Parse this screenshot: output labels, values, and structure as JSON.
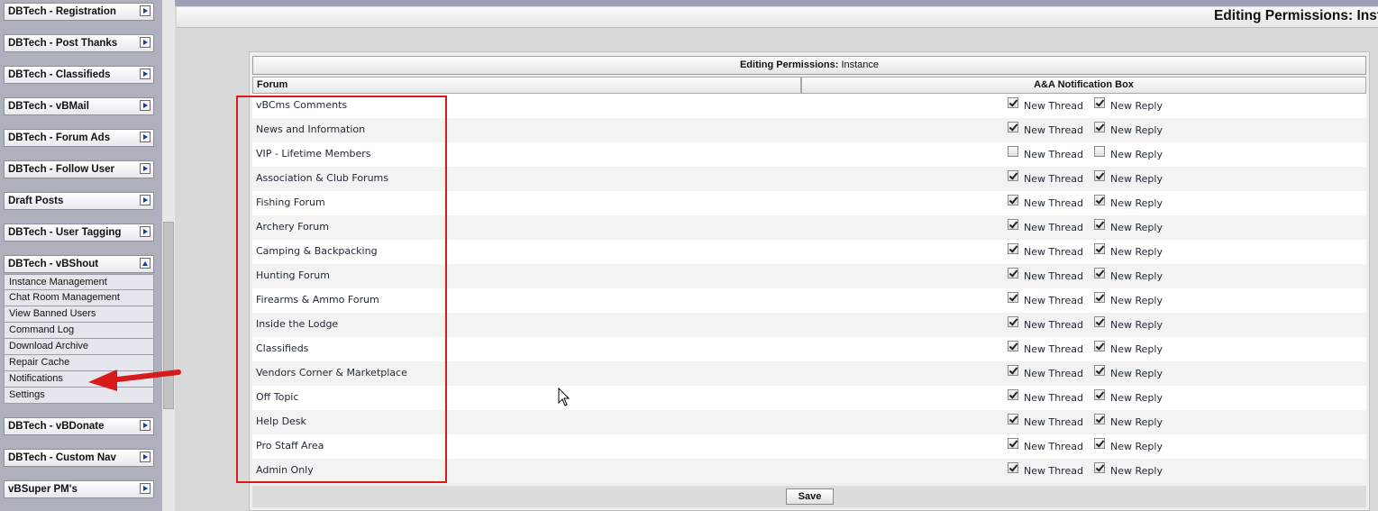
{
  "sidebar": {
    "groups": [
      {
        "label": "DBTech - Registration"
      },
      {
        "label": "DBTech - Post Thanks"
      },
      {
        "label": "DBTech - Classifieds"
      },
      {
        "label": "DBTech - vBMail"
      },
      {
        "label": "DBTech - Forum Ads"
      },
      {
        "label": "DBTech - Follow User"
      },
      {
        "label": "Draft Posts"
      },
      {
        "label": "DBTech - User Tagging"
      },
      {
        "label": "DBTech - vBShout"
      },
      {
        "label": "DBTech - vBDonate"
      },
      {
        "label": "DBTech - Custom Nav"
      },
      {
        "label": "vBSuper PM's"
      }
    ],
    "vbshout_items": [
      "Instance Management",
      "Chat Room Management",
      "View Banned Users",
      "Command Log",
      "Download Archive",
      "Repair Cache",
      "Notifications",
      "Settings"
    ]
  },
  "header": {
    "title": "Editing Permissions: Inst"
  },
  "table": {
    "title_bold": "Editing Permissions:",
    "title_rest": " Instance",
    "col_forum": "Forum",
    "col_box": "A&A Notification Box",
    "new_thread_label": "New Thread",
    "new_reply_label": "New Reply",
    "rows": [
      {
        "forum": "vBCms Comments",
        "new_thread": true,
        "new_reply": true
      },
      {
        "forum": "News and Information",
        "new_thread": true,
        "new_reply": true
      },
      {
        "forum": "VIP - Lifetime Members",
        "new_thread": false,
        "new_reply": false
      },
      {
        "forum": "Association & Club Forums",
        "new_thread": true,
        "new_reply": true
      },
      {
        "forum": "Fishing Forum",
        "new_thread": true,
        "new_reply": true
      },
      {
        "forum": "Archery Forum",
        "new_thread": true,
        "new_reply": true
      },
      {
        "forum": "Camping & Backpacking",
        "new_thread": true,
        "new_reply": true
      },
      {
        "forum": "Hunting Forum",
        "new_thread": true,
        "new_reply": true
      },
      {
        "forum": "Firearms & Ammo Forum",
        "new_thread": true,
        "new_reply": true
      },
      {
        "forum": "Inside the Lodge",
        "new_thread": true,
        "new_reply": true
      },
      {
        "forum": "Classifieds",
        "new_thread": true,
        "new_reply": true
      },
      {
        "forum": "Vendors Corner & Marketplace",
        "new_thread": true,
        "new_reply": true
      },
      {
        "forum": "Off Topic",
        "new_thread": true,
        "new_reply": true
      },
      {
        "forum": "Help Desk",
        "new_thread": true,
        "new_reply": true
      },
      {
        "forum": "Pro Staff Area",
        "new_thread": true,
        "new_reply": true
      },
      {
        "forum": "Admin Only",
        "new_thread": true,
        "new_reply": true
      }
    ],
    "save_label": "Save"
  },
  "colors": {
    "sidebar_bg": "#aeb0bc",
    "annotation_red": "#d71a1a"
  }
}
